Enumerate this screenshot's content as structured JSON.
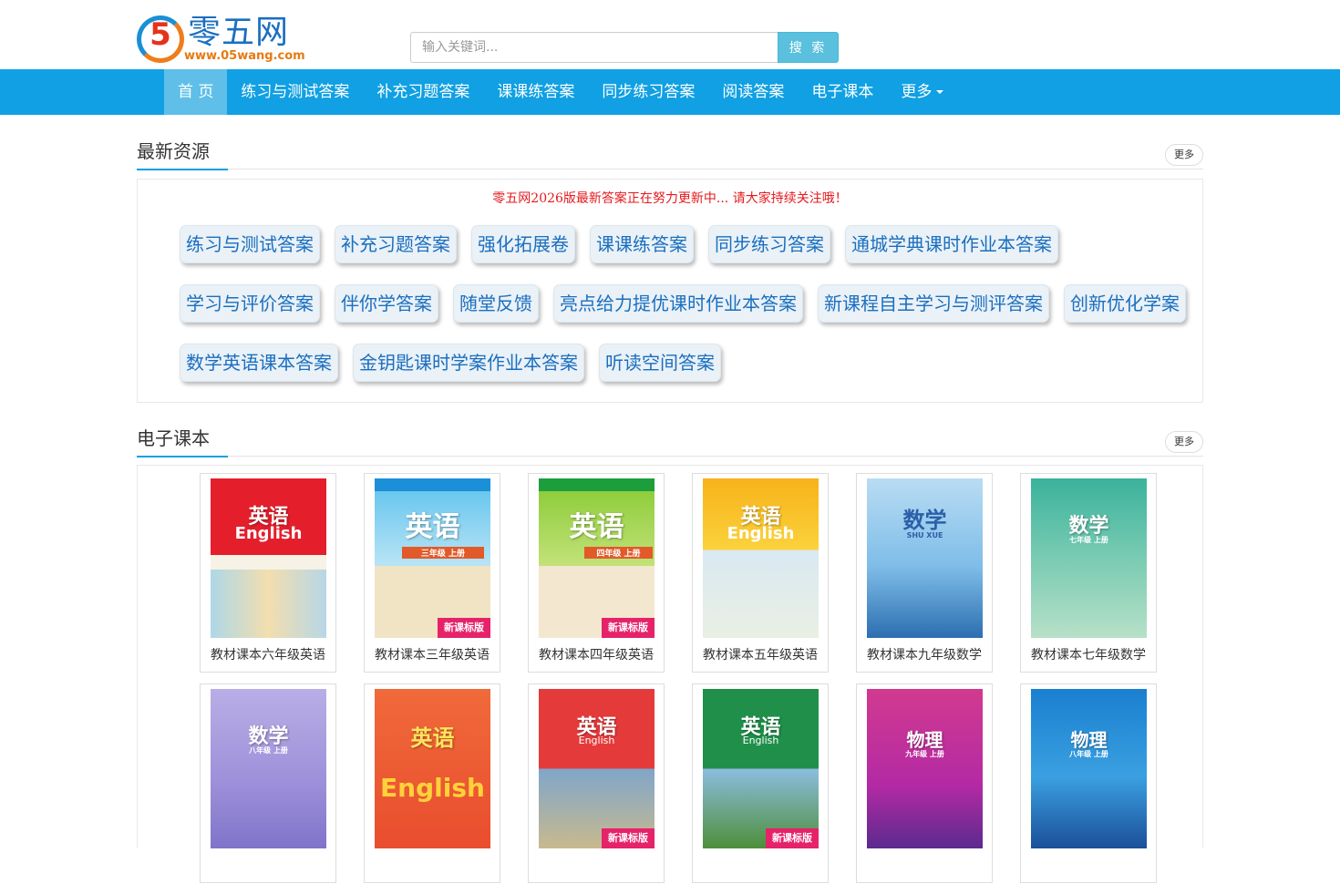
{
  "logo": {
    "digit": "5",
    "name": "零五网",
    "url": "www.05wang.com"
  },
  "search": {
    "placeholder": "输入关键词...",
    "button": "搜 索"
  },
  "nav": {
    "items": [
      "首 页",
      "练习与测试答案",
      "补充习题答案",
      "课课练答案",
      "同步练习答案",
      "阅读答案",
      "电子课本",
      "更多"
    ]
  },
  "section_latest": {
    "title": "最新资源",
    "more": "更多",
    "notice": "零五网2026版最新答案正在努力更新中... 请大家持续关注哦！",
    "tag_rows": [
      [
        "练习与测试答案",
        "补充习题答案",
        "强化拓展卷",
        "课课练答案",
        "同步练习答案",
        "通城学典课时作业本答案"
      ],
      [
        "学习与评价答案",
        "伴你学答案",
        "随堂反馈",
        "亮点给力提优课时作业本答案",
        "新课程自主学习与测评答案",
        "创新优化学案"
      ],
      [
        "数学英语课本答案",
        "金钥匙课时学案作业本答案",
        "听读空间答案"
      ]
    ]
  },
  "section_textbook": {
    "title": "电子课本",
    "more": "更多",
    "rows": [
      [
        {
          "label": "教材课本六年级英语",
          "cover_title": "英语",
          "cover_sub": "English",
          "badge": ""
        },
        {
          "label": "教材课本三年级英语",
          "cover_title": "英语",
          "cover_sub": "三年级 上册",
          "badge": "新课标版"
        },
        {
          "label": "教材课本四年级英语",
          "cover_title": "英语",
          "cover_sub": "四年级 上册",
          "badge": "新课标版"
        },
        {
          "label": "教材课本五年级英语",
          "cover_title": "英语",
          "cover_sub": "English",
          "badge": ""
        },
        {
          "label": "教材课本九年级数学",
          "cover_title": "数学",
          "cover_sub": "SHU XUE",
          "badge": ""
        },
        {
          "label": "教材课本七年级数学",
          "cover_title": "数学",
          "cover_sub": "七年级 上册",
          "badge": ""
        }
      ],
      [
        {
          "label": "",
          "cover_title": "数学",
          "cover_sub": "八年级 上册",
          "badge": ""
        },
        {
          "label": "",
          "cover_title": "英语",
          "cover_sub": "English",
          "badge": ""
        },
        {
          "label": "",
          "cover_title": "英语",
          "cover_sub": "English",
          "badge": "新课标版"
        },
        {
          "label": "",
          "cover_title": "英语",
          "cover_sub": "English",
          "badge": "新课标版"
        },
        {
          "label": "",
          "cover_title": "物理",
          "cover_sub": "九年级 上册",
          "badge": ""
        },
        {
          "label": "",
          "cover_title": "物理",
          "cover_sub": "八年级 上册",
          "badge": ""
        }
      ]
    ]
  },
  "colors": {
    "nav_bg": "#10a0e3",
    "nav_active": "#5fbfe8",
    "tag_text": "#1a6fbf",
    "notice_text": "#e4191c",
    "search_button": "#5bc0de"
  }
}
